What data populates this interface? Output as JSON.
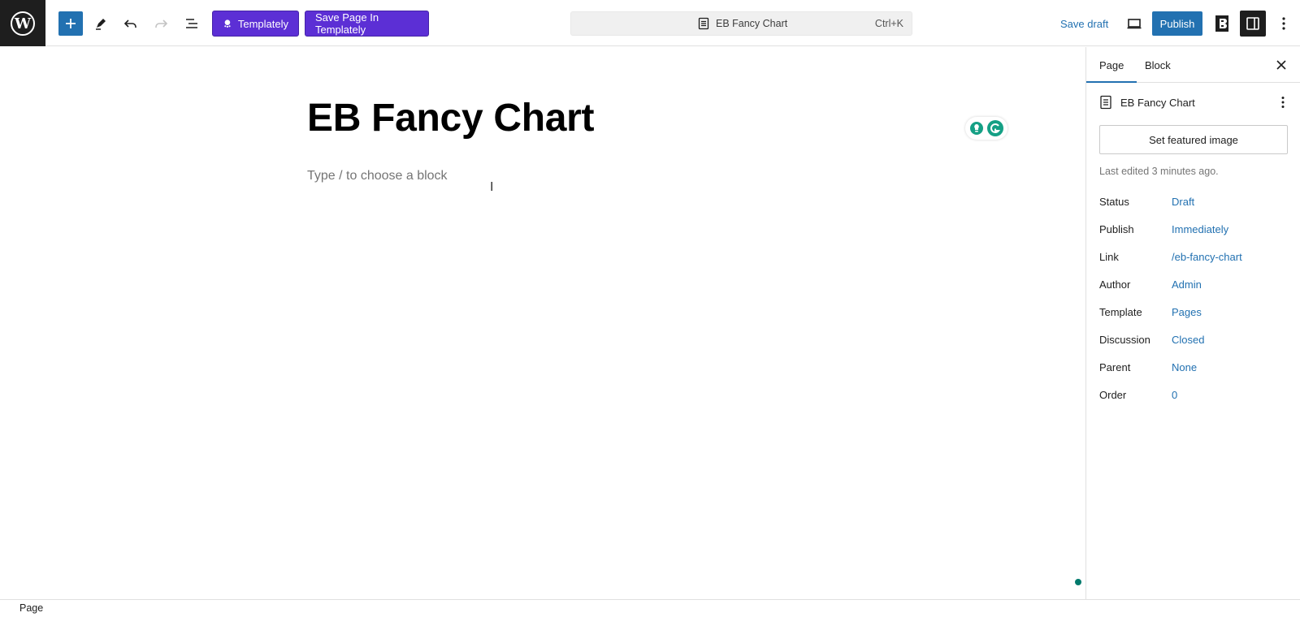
{
  "toolbar": {
    "wp_logo_icon": "wordpress-logo-icon",
    "add_icon": "plus-icon",
    "tools_icon": "pencil-icon",
    "undo_icon": "undo-icon",
    "redo_icon": "redo-icon",
    "list_view_icon": "document-overview-icon",
    "templately_label": "Templately",
    "save_templately_label": "Save Page In Templately",
    "command_title": "EB Fancy Chart",
    "command_shortcut": "Ctrl+K",
    "save_draft_label": "Save draft",
    "preview_icon": "desktop-preview-icon",
    "publish_label": "Publish",
    "eb_icon": "essential-blocks-icon",
    "settings_icon": "sidebar-toggle-icon",
    "options_icon": "more-vertical-icon",
    "accent_color": "#2271b1",
    "templately_color": "#5c2fd5"
  },
  "editor": {
    "title": "EB Fancy Chart",
    "block_placeholder": "Type / to choose a block",
    "cursor_glyph": "I",
    "grammarly_icons": [
      "bulb-icon",
      "grammarly-icon"
    ]
  },
  "sidebar": {
    "tabs": [
      {
        "label": "Page",
        "active": true
      },
      {
        "label": "Block",
        "active": false
      }
    ],
    "doc_title": "EB Fancy Chart",
    "featured_image_label": "Set featured image",
    "last_edited": "Last edited 3 minutes ago.",
    "meta": [
      {
        "label": "Status",
        "value": "Draft"
      },
      {
        "label": "Publish",
        "value": "Immediately"
      },
      {
        "label": "Link",
        "value": "/eb-fancy-chart"
      },
      {
        "label": "Author",
        "value": "Admin"
      },
      {
        "label": "Template",
        "value": "Pages"
      },
      {
        "label": "Discussion",
        "value": "Closed"
      },
      {
        "label": "Parent",
        "value": "None"
      },
      {
        "label": "Order",
        "value": "0"
      }
    ]
  },
  "footer": {
    "breadcrumb": "Page"
  }
}
